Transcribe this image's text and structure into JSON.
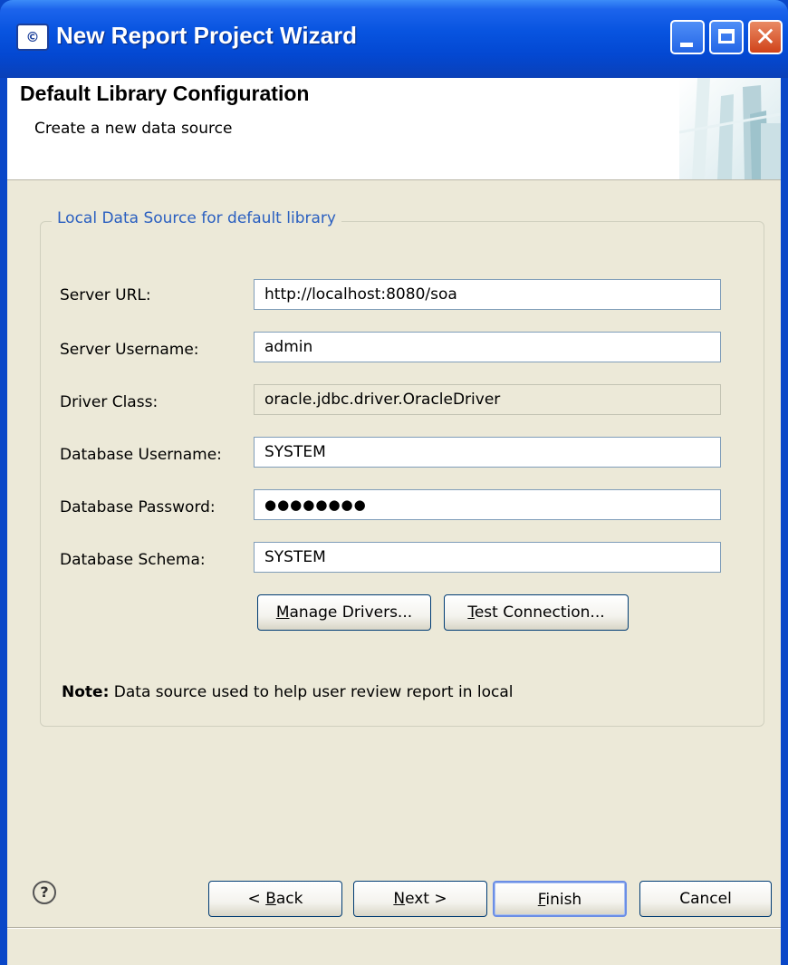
{
  "window": {
    "title": "New Report Project Wizard",
    "app_icon_text": "©",
    "title_buttons": [
      "minimize",
      "maximize",
      "close"
    ]
  },
  "header": {
    "title": "Default Library Configuration",
    "description": "Create a new data source"
  },
  "group": {
    "legend": "Local Data Source for default library"
  },
  "form": {
    "server_url": {
      "label": "Server URL:",
      "value": "http://localhost:8080/soa"
    },
    "server_username": {
      "label": "Server Username:",
      "value": "admin"
    },
    "driver_class": {
      "label": "Driver Class:",
      "value": "oracle.jdbc.driver.OracleDriver"
    },
    "database_username": {
      "label": "Database Username:",
      "value": "SYSTEM"
    },
    "database_password": {
      "label": "Database Password:",
      "value": "●●●●●●●●"
    },
    "database_schema": {
      "label": "Database Schema:",
      "value": "SYSTEM"
    }
  },
  "actions": {
    "manage_drivers": {
      "label_mnemonic": "M",
      "label_rest": "anage Drivers..."
    },
    "test_connection": {
      "label_mnemonic": "T",
      "label_rest": "est Connection..."
    }
  },
  "note": {
    "label": "Note:",
    "text": " Data source used to help user review report in local"
  },
  "footer": {
    "help_icon": "?",
    "back": {
      "prefix": "< ",
      "mnemonic": "B",
      "rest": "ack"
    },
    "next": {
      "mnemonic": "N",
      "rest": "ext >"
    },
    "finish": {
      "mnemonic": "F",
      "rest": "inish"
    },
    "cancel": {
      "label": "Cancel"
    }
  }
}
